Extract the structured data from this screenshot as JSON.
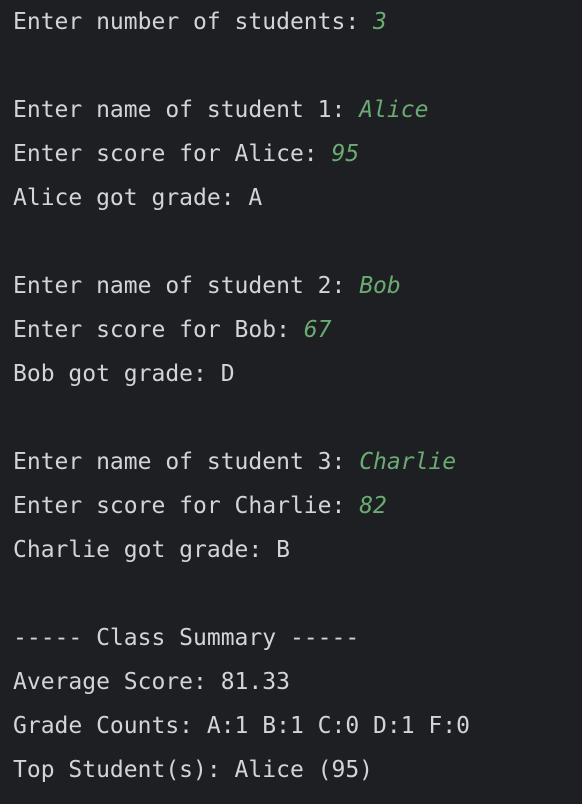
{
  "colors": {
    "background": "#1e1f22",
    "output_text": "#d2d4d8",
    "user_input_text": "#6aab73"
  },
  "console": {
    "lines": [
      {
        "prompt": "Enter number of students: ",
        "input": "3"
      },
      {
        "prompt": "",
        "input": ""
      },
      {
        "prompt": "Enter name of student 1: ",
        "input": "Alice"
      },
      {
        "prompt": "Enter score for Alice: ",
        "input": "95"
      },
      {
        "prompt": "Alice got grade: A",
        "input": ""
      },
      {
        "prompt": "",
        "input": ""
      },
      {
        "prompt": "Enter name of student 2: ",
        "input": "Bob"
      },
      {
        "prompt": "Enter score for Bob: ",
        "input": "67"
      },
      {
        "prompt": "Bob got grade: D",
        "input": ""
      },
      {
        "prompt": "",
        "input": ""
      },
      {
        "prompt": "Enter name of student 3: ",
        "input": "Charlie"
      },
      {
        "prompt": "Enter score for Charlie: ",
        "input": "82"
      },
      {
        "prompt": "Charlie got grade: B",
        "input": ""
      },
      {
        "prompt": "",
        "input": ""
      },
      {
        "prompt": "----- Class Summary -----",
        "input": ""
      },
      {
        "prompt": "Average Score: 81.33",
        "input": ""
      },
      {
        "prompt": "Grade Counts: A:1 B:1 C:0 D:1 F:0",
        "input": ""
      },
      {
        "prompt": "Top Student(s): Alice (95)",
        "input": ""
      }
    ]
  }
}
